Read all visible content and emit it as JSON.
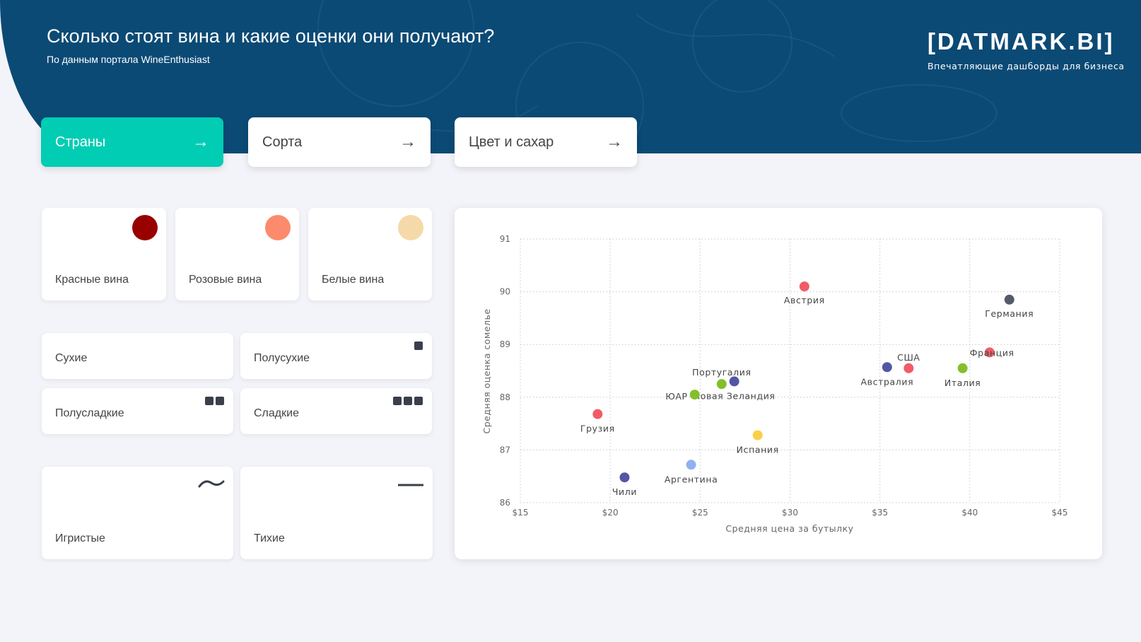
{
  "header": {
    "title": "Сколько стоят вина и какие оценки они получают?",
    "subtitle": "По данным портала WineEnthusiast",
    "logo": "[DATMARK.BI]",
    "logo_tagline": "Впечатляющие дашборды для бизнеса",
    "background_color": "#0b4a75"
  },
  "nav": {
    "items": [
      {
        "label": "Страны",
        "active": true
      },
      {
        "label": "Сорта",
        "active": false
      },
      {
        "label": "Цвет и сахар",
        "active": false
      }
    ],
    "arrow_icon": "→",
    "accent_color": "#00cdb4"
  },
  "filters": {
    "color": [
      {
        "label": "Красные вина",
        "color": "#990000"
      },
      {
        "label": "Розовые вина",
        "color": "#fc8a6d"
      },
      {
        "label": "Белые вина",
        "color": "#f5d9a8"
      }
    ],
    "sugar": [
      {
        "label": "Сухие",
        "squares": 0
      },
      {
        "label": "Полусухие",
        "squares": 1
      },
      {
        "label": "Полусладкие",
        "squares": 2
      },
      {
        "label": "Сладкие",
        "squares": 3
      }
    ],
    "type": [
      {
        "label": "Игристые",
        "icon": "wave-icon"
      },
      {
        "label": "Тихие",
        "icon": "flat-line-icon"
      }
    ]
  },
  "chart_data": {
    "type": "scatter",
    "xlabel": "Средняя цена за бутылку",
    "ylabel": "Средняя оценка сомелье",
    "xlim": [
      15,
      45
    ],
    "ylim": [
      86,
      91
    ],
    "xticks": [
      15,
      20,
      25,
      30,
      35,
      40,
      45
    ],
    "xtick_labels": [
      "$15",
      "$20",
      "$25",
      "$30",
      "$35",
      "$40",
      "$45"
    ],
    "yticks": [
      86,
      87,
      88,
      89,
      90,
      91
    ],
    "grid": true,
    "points": [
      {
        "label": "Австрия",
        "x": 30.8,
        "y": 90.1,
        "color": "#f05c66"
      },
      {
        "label": "Германия",
        "x": 42.2,
        "y": 89.85,
        "color": "#555b66"
      },
      {
        "label": "Франция",
        "x": 41.1,
        "y": 88.85,
        "color": "#f05c66"
      },
      {
        "label": "США",
        "x": 36.6,
        "y": 88.55,
        "color": "#f05c66"
      },
      {
        "label": "Австралия",
        "x": 35.4,
        "y": 88.57,
        "color": "#5356a5"
      },
      {
        "label": "Италия",
        "x": 39.6,
        "y": 88.55,
        "color": "#84bf2b"
      },
      {
        "label": "Португалия",
        "x": 26.2,
        "y": 88.25,
        "color": "#84bf2b"
      },
      {
        "label": "Новая Зеландия",
        "x": 26.9,
        "y": 88.3,
        "color": "#5356a5"
      },
      {
        "label": "ЮАР",
        "x": 24.7,
        "y": 88.05,
        "color": "#84bf2b"
      },
      {
        "label": "Грузия",
        "x": 19.3,
        "y": 87.68,
        "color": "#f05c66"
      },
      {
        "label": "Испания",
        "x": 28.2,
        "y": 87.28,
        "color": "#fad04a"
      },
      {
        "label": "Аргентина",
        "x": 24.5,
        "y": 86.72,
        "color": "#8fb1ef"
      },
      {
        "label": "Чили",
        "x": 20.8,
        "y": 86.48,
        "color": "#5356a5"
      }
    ]
  }
}
